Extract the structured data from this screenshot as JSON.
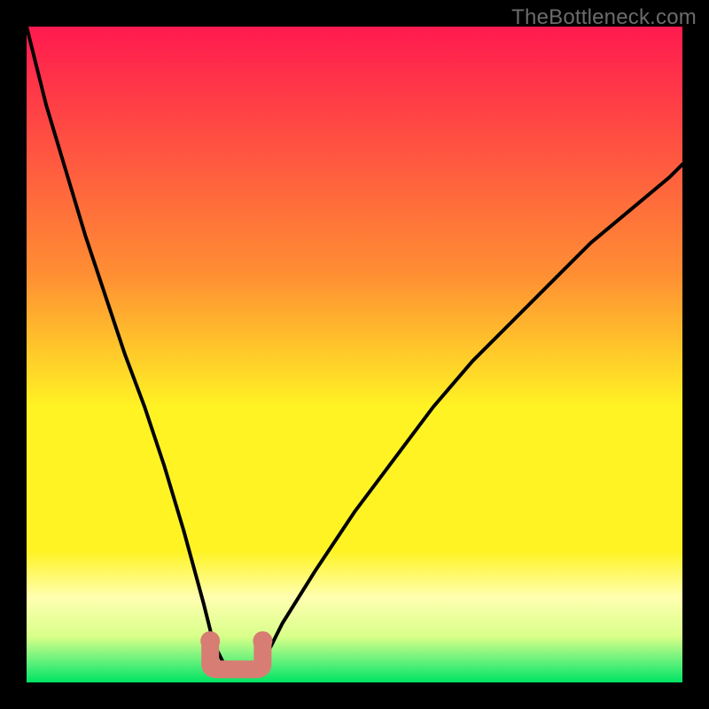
{
  "watermark": "TheBottleneck.com",
  "chart_data": {
    "type": "line",
    "title": "",
    "xlabel": "",
    "ylabel": "",
    "xlim": [
      0,
      100
    ],
    "ylim": [
      0,
      100
    ],
    "grid": false,
    "legend": false,
    "colors": {
      "gradient_top": "#ff1a4f",
      "gradient_mid_orange": "#ffa531",
      "gradient_mid_yellow": "#fff324",
      "gradient_pale_yellow": "#ffffb0",
      "gradient_bottom": "#00e463",
      "curve": "#000000",
      "marker": "#d87d73"
    },
    "series": [
      {
        "name": "bottleneck-curve",
        "x": [
          0,
          3,
          6,
          9,
          12,
          15,
          18,
          21,
          24,
          27,
          28.5,
          30,
          31.5,
          33,
          35,
          37,
          39,
          44,
          50,
          56,
          62,
          68,
          74,
          80,
          86,
          92,
          98,
          100
        ],
        "y": [
          100,
          88,
          78,
          68,
          59,
          50,
          42,
          33,
          23,
          12,
          6,
          3,
          2,
          2,
          3,
          5,
          9,
          17,
          26,
          34,
          42,
          49,
          55,
          61,
          67,
          72,
          77,
          79
        ]
      }
    ],
    "annotations": [
      {
        "name": "optimal-region-u-mark",
        "x_range": [
          28,
          36
        ],
        "y": 2
      }
    ]
  }
}
